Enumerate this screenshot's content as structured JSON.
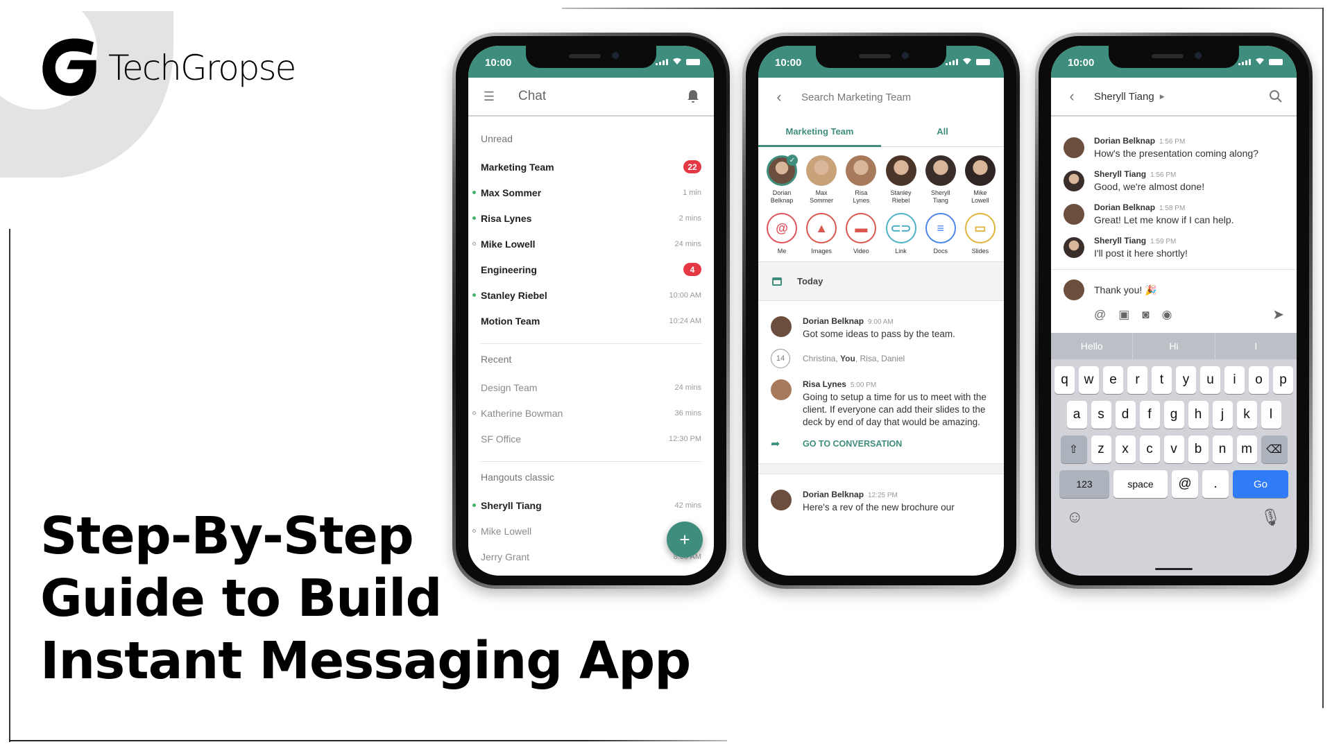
{
  "brand": {
    "name": "TechGropse"
  },
  "headline": [
    "Step-By-Step",
    "Guide to Build",
    "Instant Messaging App"
  ],
  "theme": {
    "accent": "#3f8e7d",
    "badge": "#e53845",
    "online": "#45b36b",
    "keyboard_go": "#2f7cf6"
  },
  "status_bar": {
    "time": "10:00"
  },
  "phone1": {
    "title": "Chat",
    "sections": [
      {
        "label": "Unread",
        "rows": [
          {
            "name": "Marketing Team",
            "badge": "22",
            "meta": null,
            "presence": null,
            "style": "bold"
          },
          {
            "name": "Max Sommer",
            "meta": "1 min",
            "presence": "online",
            "style": "bold"
          },
          {
            "name": "Risa Lynes",
            "meta": "2 mins",
            "presence": "online",
            "style": "bold"
          },
          {
            "name": "Mike Lowell",
            "meta": "24 mins",
            "presence": "offline",
            "style": "bold"
          },
          {
            "name": "Engineering",
            "badge": "4",
            "meta": null,
            "presence": null,
            "style": "bold"
          },
          {
            "name": "Stanley Riebel",
            "meta": "10:00 AM",
            "presence": "online",
            "style": "bold"
          },
          {
            "name": "Motion Team",
            "meta": "10:24 AM",
            "presence": null,
            "style": "bold"
          }
        ]
      },
      {
        "label": "Recent",
        "rows": [
          {
            "name": "Design Team",
            "meta": "24 mins",
            "presence": null,
            "style": "light"
          },
          {
            "name": "Katherine Bowman",
            "meta": "36 mins",
            "presence": "offline",
            "style": "light"
          },
          {
            "name": "SF Office",
            "meta": "12:30 PM",
            "presence": null,
            "style": "light"
          }
        ]
      },
      {
        "label": "Hangouts classic",
        "rows": [
          {
            "name": "Sheryll Tiang",
            "meta": "42 mins",
            "presence": "online",
            "style": "bold"
          },
          {
            "name": "Mike Lowell",
            "meta": "",
            "presence": "offline",
            "style": "light"
          },
          {
            "name": "Jerry Grant",
            "meta": "8:00 AM",
            "presence": null,
            "style": "light"
          }
        ]
      }
    ],
    "fab_label": "+"
  },
  "phone2": {
    "search_placeholder": "Search Marketing Team",
    "tabs": [
      {
        "label": "Marketing Team",
        "active": true
      },
      {
        "label": "All",
        "active": false
      }
    ],
    "people": [
      {
        "first": "Dorian",
        "last": "Belknap",
        "selected": true,
        "color": "#6b4e3d"
      },
      {
        "first": "Max",
        "last": "Sommer",
        "selected": false,
        "color": "#c9a27a"
      },
      {
        "first": "Risa",
        "last": "Lynes",
        "selected": false,
        "color": "#a87a5c"
      },
      {
        "first": "Stanley",
        "last": "Riebel",
        "selected": false,
        "color": "#4a3528"
      },
      {
        "first": "Sheryll",
        "last": "Tiang",
        "selected": false,
        "color": "#3a2e2a"
      },
      {
        "first": "Mike",
        "last": "Lowell",
        "selected": false,
        "color": "#2f2623"
      }
    ],
    "shortcuts": [
      {
        "label": "Me",
        "glyph": "@",
        "color": "#e0525b"
      },
      {
        "label": "Images",
        "glyph": "▲",
        "color": "#d9574d"
      },
      {
        "label": "Video",
        "glyph": "▬",
        "color": "#d9574d"
      },
      {
        "label": "Link",
        "glyph": "⊂⊃",
        "color": "#4fb0c6"
      },
      {
        "label": "Docs",
        "glyph": "≡",
        "color": "#4a86e8"
      },
      {
        "label": "Slides",
        "glyph": "▭",
        "color": "#e0b43a"
      }
    ],
    "date_header": "Today",
    "messages": [
      {
        "author": "Dorian Belknap",
        "time": "9:00 AM",
        "text": "Got some ideas to pass by the team."
      },
      {
        "author": "Risa Lynes",
        "time": "5:00 PM",
        "text": "Going to setup a time for us to meet with the client. If everyone can add their slides to the deck by end of day that would be amazing."
      },
      {
        "author": "Dorian Belknap",
        "time": "12:25 PM",
        "text": "Here's a rev of the new brochure our"
      }
    ],
    "readers": {
      "count": "14",
      "names_before": "Christina, ",
      "you": "You",
      "names_after": ", Risa, Daniel"
    },
    "goto_label": "GO TO CONVERSATION"
  },
  "phone3": {
    "contact": "Sheryll Tiang",
    "messages": [
      {
        "author": "Dorian Belknap",
        "time": "1:56 PM",
        "text": "How's the presentation coming along?"
      },
      {
        "author": "Sheryll Tiang",
        "time": "1:56 PM",
        "text": "Good, we're almost done!"
      },
      {
        "author": "Dorian Belknap",
        "time": "1:58 PM",
        "text": "Great! Let me know if I can help."
      },
      {
        "author": "Sheryll Tiang",
        "time": "1:59 PM",
        "text": "I'll post it here shortly!"
      }
    ],
    "draft": "Thank you! 🎉",
    "suggestions": [
      "Hello",
      "Hi",
      "I"
    ],
    "keyboard": {
      "row1": [
        "q",
        "w",
        "e",
        "r",
        "t",
        "y",
        "u",
        "i",
        "o",
        "p"
      ],
      "row2": [
        "a",
        "s",
        "d",
        "f",
        "g",
        "h",
        "j",
        "k",
        "l"
      ],
      "row3": [
        "z",
        "x",
        "c",
        "v",
        "b",
        "n",
        "m"
      ],
      "numbers": "123",
      "space": "space",
      "at": "@",
      "period": ".",
      "go": "Go"
    }
  }
}
